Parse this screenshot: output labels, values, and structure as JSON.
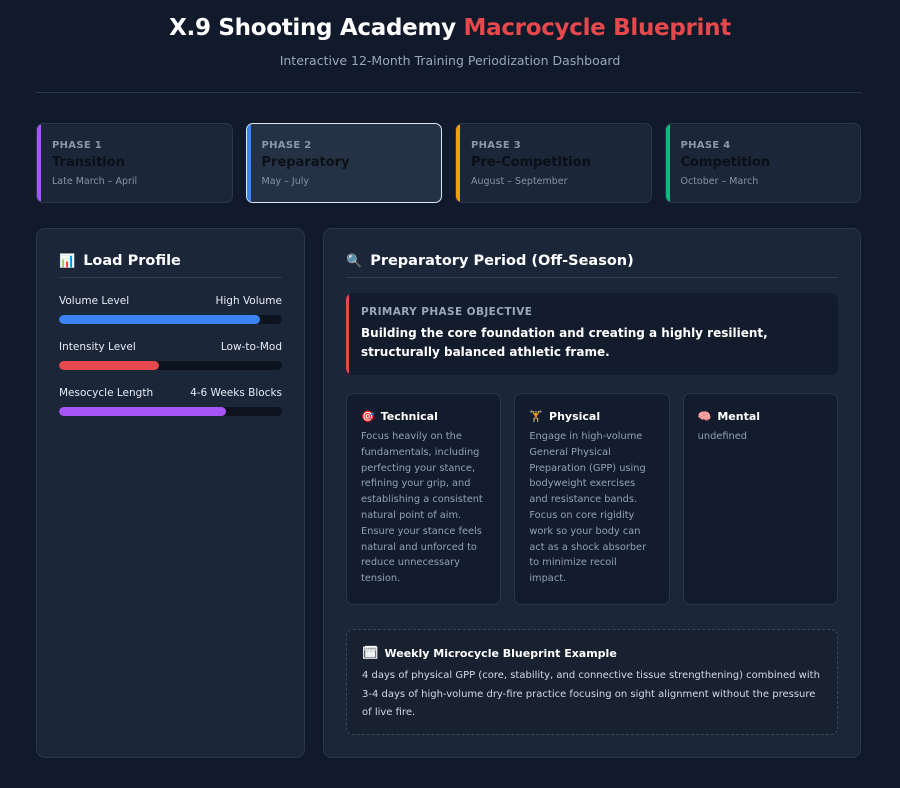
{
  "header": {
    "title_main": "X.9 Shooting Academy",
    "title_accent": "Macrocycle Blueprint",
    "subtitle": "Interactive 12-Month Training Periodization Dashboard"
  },
  "phases": [
    {
      "number": "PHASE 1",
      "name": "Transition",
      "dates": "Late March – April",
      "color": "#a855f7",
      "active": false
    },
    {
      "number": "PHASE 2",
      "name": "Preparatory",
      "dates": "May – July",
      "color": "#3b82f6",
      "active": true
    },
    {
      "number": "PHASE 3",
      "name": "Pre-Competition",
      "dates": "August – September",
      "color": "#f59e0b",
      "active": false
    },
    {
      "number": "PHASE 4",
      "name": "Competition",
      "dates": "October – March",
      "color": "#10b981",
      "active": false
    }
  ],
  "load_profile": {
    "icon": "bar-chart-icon",
    "emoji": "📊",
    "title": "Load Profile",
    "metrics": [
      {
        "label": "Volume Level",
        "value": "High Volume",
        "percent": 90,
        "color": "#3b82f6"
      },
      {
        "label": "Intensity Level",
        "value": "Low-to-Mod",
        "percent": 45,
        "color": "#e5484d"
      },
      {
        "label": "Mesocycle Length",
        "value": "4-6 Weeks Blocks",
        "percent": 75,
        "color": "#a855f7"
      }
    ]
  },
  "detail": {
    "icon": "magnifier-icon",
    "emoji": "🔍",
    "title": "Preparatory Period (Off-Season)",
    "objective_label": "PRIMARY PHASE OBJECTIVE",
    "objective_text": "Building the core foundation and creating a highly resilient, structurally balanced athletic frame.",
    "columns": [
      {
        "emoji": "🎯",
        "icon": "target-icon",
        "title": "Technical",
        "text": "Focus heavily on the fundamentals, including perfecting your stance, refining your grip, and establishing a consistent natural point of aim. Ensure your stance feels natural and unforced to reduce unnecessary tension."
      },
      {
        "emoji": "🏋",
        "icon": "weightlifter-icon",
        "title": "Physical",
        "text": "Engage in high-volume General Physical Preparation (GPP) using bodyweight exercises and resistance bands. Focus on core rigidity work so your body can act as a shock absorber to minimize recoil impact."
      },
      {
        "emoji": "🧠",
        "icon": "brain-icon",
        "title": "Mental",
        "text": "undefined"
      }
    ],
    "weekly": {
      "emoji": "🗓",
      "icon": "calendar-icon",
      "title": "Weekly Microcycle Blueprint Example",
      "text": "4 days of physical GPP (core, stability, and connective tissue strengthening) combined with 3-4 days of high-volume dry-fire practice focusing on sight alignment without the pressure of live fire."
    }
  }
}
